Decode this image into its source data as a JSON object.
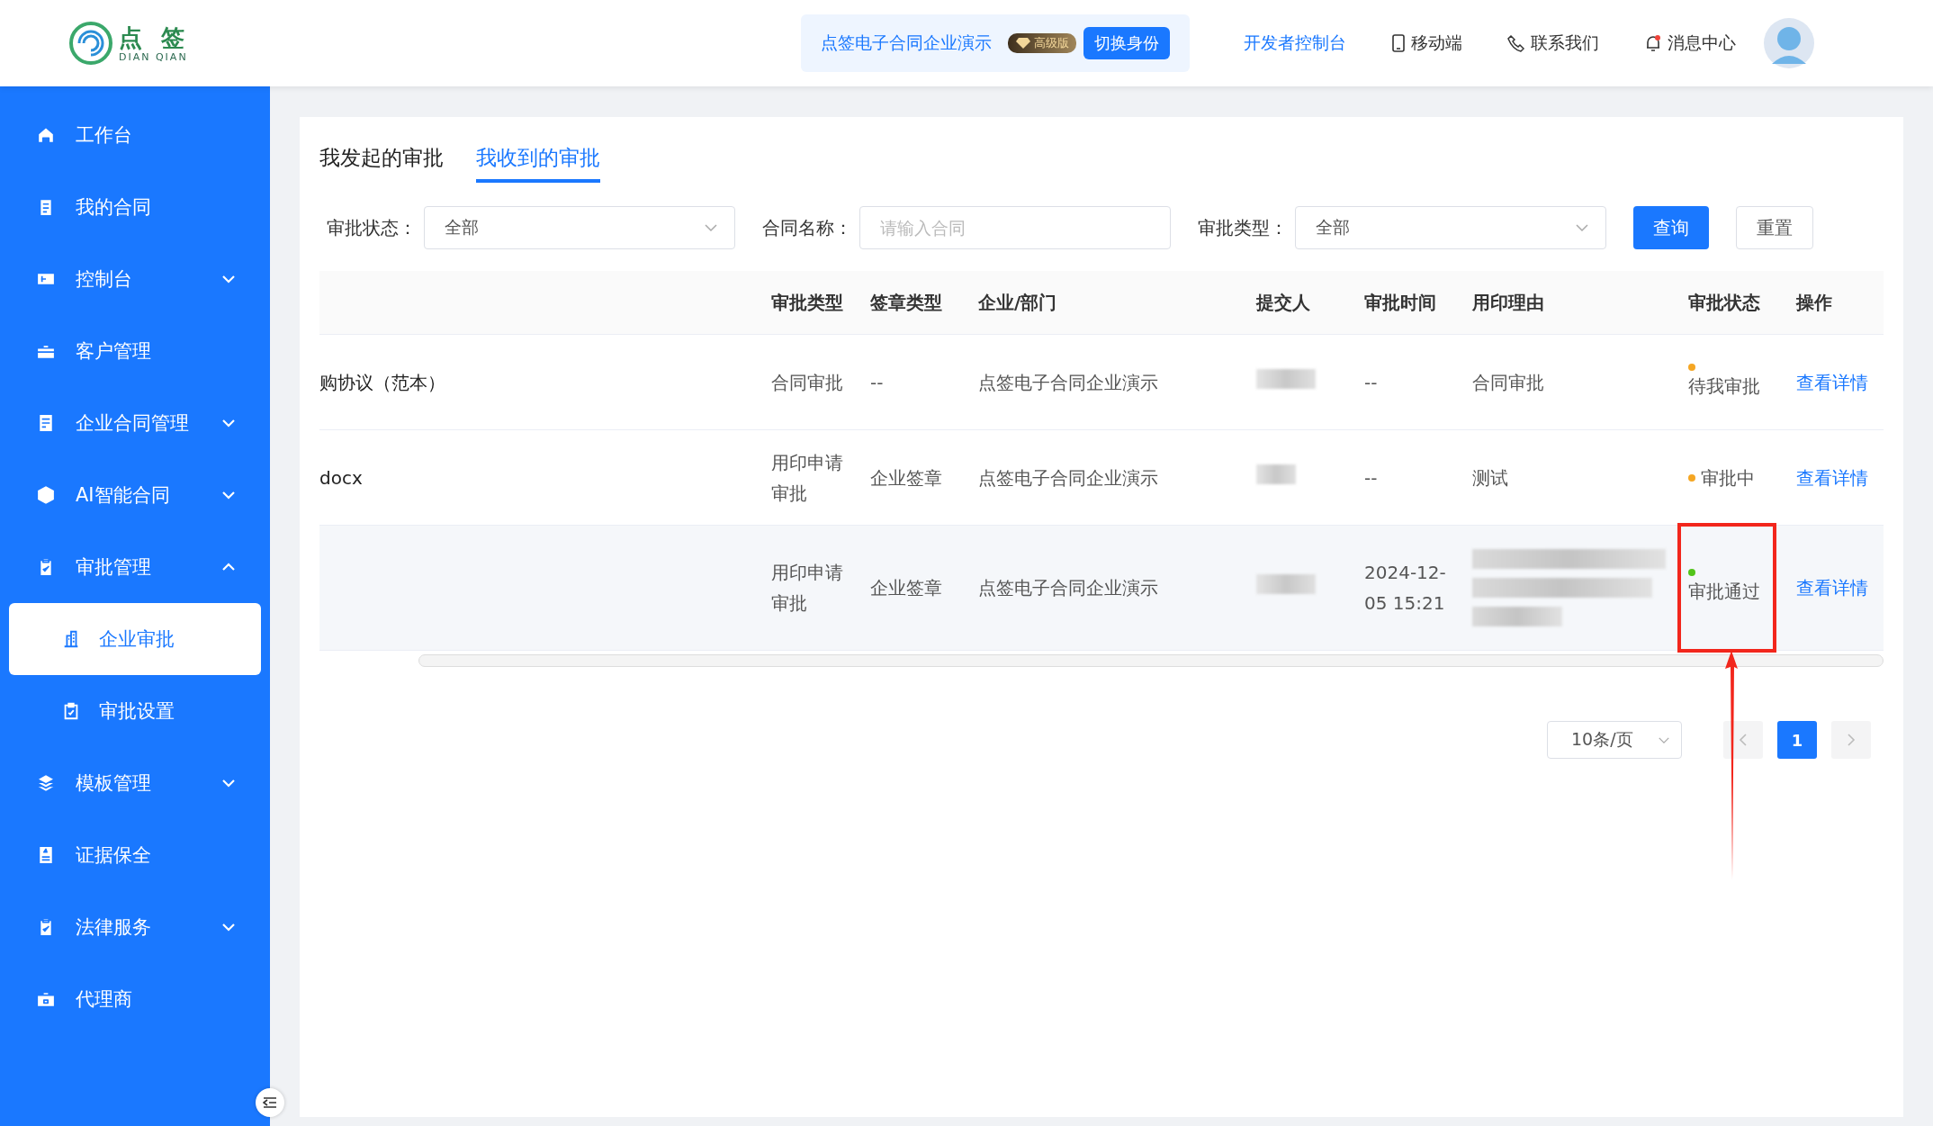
{
  "header": {
    "logo_name": "点 签",
    "logo_sub": "DIAN QIAN",
    "company": "点签电子合同企业演示",
    "plan_badge": "高级版",
    "switch_button": "切换身份",
    "links": [
      {
        "label": "开发者控制台",
        "kind": "plain"
      },
      {
        "label": "移动端",
        "kind": "mobile"
      },
      {
        "label": "联系我们",
        "kind": "phone"
      },
      {
        "label": "消息中心",
        "kind": "bell"
      }
    ]
  },
  "sidebar": {
    "items": [
      {
        "label": "工作台",
        "kind": "link",
        "selected": false
      },
      {
        "label": "我的合同",
        "kind": "link",
        "selected": false
      },
      {
        "label": "控制台",
        "kind": "group",
        "expanded": false,
        "selected": false
      },
      {
        "label": "客户管理",
        "kind": "link",
        "selected": false
      },
      {
        "label": "企业合同管理",
        "kind": "group",
        "expanded": false,
        "selected": false
      },
      {
        "label": "AI智能合同",
        "kind": "group",
        "expanded": false,
        "selected": false
      },
      {
        "label": "审批管理",
        "kind": "group",
        "expanded": true,
        "selected": false,
        "children": [
          {
            "label": "企业审批",
            "selected": true
          },
          {
            "label": "审批设置",
            "selected": false
          }
        ]
      },
      {
        "label": "模板管理",
        "kind": "group",
        "expanded": false,
        "selected": false
      },
      {
        "label": "证据保全",
        "kind": "link",
        "selected": false
      },
      {
        "label": "法律服务",
        "kind": "group",
        "expanded": false,
        "selected": false
      },
      {
        "label": "代理商",
        "kind": "link",
        "selected": false
      }
    ]
  },
  "tabs": [
    {
      "label": "我发起的审批",
      "selected": false
    },
    {
      "label": "我收到的审批",
      "selected": true
    }
  ],
  "filters": [
    {
      "label": "审批状态：",
      "kind": "select",
      "value": "全部"
    },
    {
      "label": "合同名称：",
      "kind": "input",
      "placeholder": "请输入合同"
    },
    {
      "label": "审批类型：",
      "kind": "select",
      "value": "全部"
    }
  ],
  "buttons": [
    {
      "label": "查询",
      "kind": "primary"
    },
    {
      "label": "重置",
      "kind": "default"
    }
  ],
  "table": {
    "columns": [
      "",
      "审批类型",
      "签章类型",
      "企业/部门",
      "提交人",
      "审批时间",
      "用印理由",
      "审批状态",
      "操作"
    ],
    "rows": [
      {
        "name": "购协议（范本）",
        "approval_type": "合同审批",
        "seal_type": "--",
        "department": "点签电子合同企业演示",
        "time": "--",
        "reason": "合同审批",
        "status": "待我审批",
        "color": "#f5a623",
        "action": "查看详情",
        "highlighted": false,
        "hovered": false
      },
      {
        "name": "docx",
        "approval_type": "用印申请审批",
        "seal_type": "企业签章",
        "department": "点签电子合同企业演示",
        "time": "--",
        "reason": "测试",
        "status": "审批中",
        "color": "#f5a623",
        "action": "查看详情",
        "highlighted": false,
        "hovered": false
      },
      {
        "name": "",
        "approval_type": "用印申请审批",
        "seal_type": "企业签章",
        "department": "点签电子合同企业演示",
        "time": "2024-12-05 15:21",
        "reason": "",
        "status": "审批通过",
        "color": "#52c41a",
        "action": "查看详情",
        "highlighted": true,
        "hovered": true
      }
    ]
  },
  "pagination": {
    "page_size": "10条/页",
    "pages": [
      {
        "label": "1",
        "selected": true
      }
    ]
  }
}
